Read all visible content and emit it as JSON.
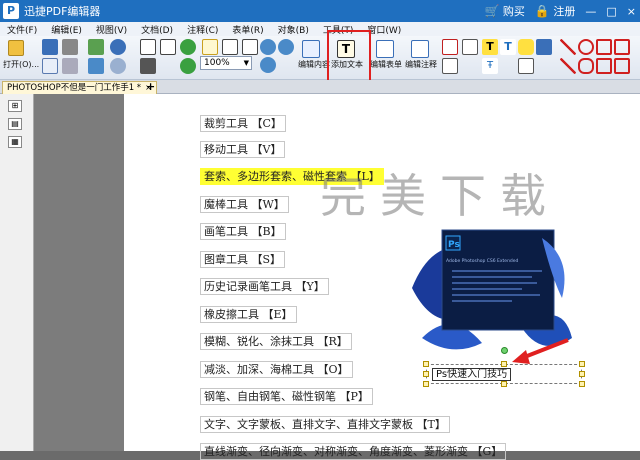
{
  "app": {
    "logo": "P",
    "title": "迅捷PDF编辑器"
  },
  "titlebar": {
    "buy": "购买",
    "register": "注册",
    "min": "—",
    "restore": "□",
    "close": "×"
  },
  "menu": [
    "文件(F)",
    "编辑(E)",
    "视图(V)",
    "文档(D)",
    "注释(C)",
    "表单(R)",
    "对象(B)",
    "工具(T)",
    "窗口(W)"
  ],
  "toolbar": {
    "open": "打开(O)...",
    "zoom": "100%",
    "edit_content": "编辑内容",
    "add_text": "添加文本",
    "edit_form": "编辑表单",
    "edit_annotation": "编辑注释"
  },
  "tab": {
    "label": "PHOTOSHOP不但是一门工作手1 *",
    "close": "×",
    "add": "+"
  },
  "document": {
    "lines": [
      "裁剪工具 【C】",
      "移动工具 【V】",
      "套索、多边形套索、磁性套索 【L】",
      "魔棒工具 【W】",
      "画笔工具 【B】",
      "图章工具 【S】",
      "历史记录画笔工具 【Y】",
      "橡皮擦工具 【E】",
      "模糊、锐化、涂抹工具 【R】",
      "减淡、加深、海棉工具 【O】",
      "钢笔、自由钢笔、磁性钢笔 【P】",
      "文字、文字蒙板、直排文字、直排文字蒙板 【T】",
      "直线渐变、径向渐变、对称渐变、角度渐变、菱形渐变 【G】"
    ],
    "watermark": "完美下载",
    "ps_logo": "Ps",
    "ps_splash_title": "Adobe Photoshop CS6 Extended",
    "added_text": "Ps快速入门技巧"
  },
  "colors": {
    "titlebar": "#1f6fbf",
    "highlight": "#ffff33",
    "callout": "#e02020"
  }
}
